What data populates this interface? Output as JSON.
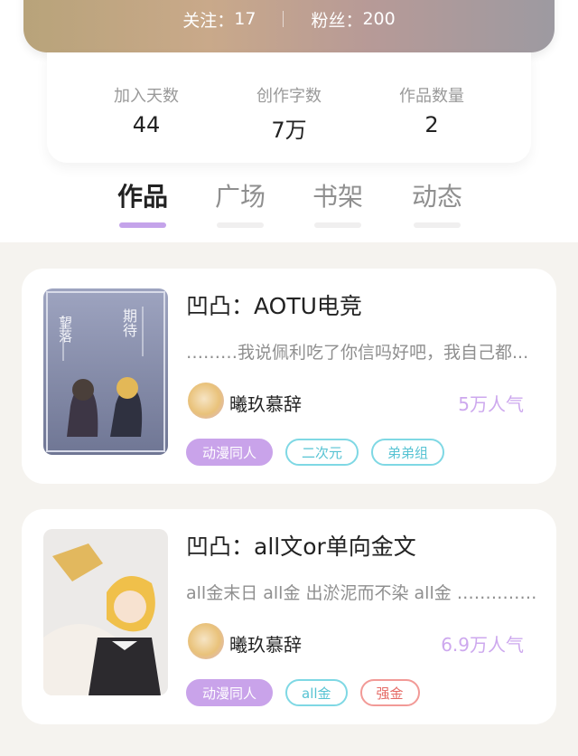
{
  "profile": {
    "following_label": "关注：",
    "following_value": "17",
    "fans_label": "粉丝：",
    "fans_value": "200"
  },
  "stats": [
    {
      "label": "加入天数",
      "value": "44"
    },
    {
      "label": "创作字数",
      "value": "7万"
    },
    {
      "label": "作品数量",
      "value": "2"
    }
  ],
  "tabs": [
    {
      "label": "作品",
      "active": true
    },
    {
      "label": "广场",
      "active": false
    },
    {
      "label": "书架",
      "active": false
    },
    {
      "label": "动态",
      "active": false
    }
  ],
  "works": [
    {
      "title": "凹凸：AOTU电竞",
      "excerpt": "………我说佩利吃了你信吗好吧，我自己都...",
      "author": "曦玖慕辞",
      "popularity": "5万人气",
      "cover_text": [
        "望落",
        "期待"
      ],
      "tags": [
        {
          "label": "动漫同人",
          "style": "fill"
        },
        {
          "label": "二次元",
          "style": "cyan"
        },
        {
          "label": "弟弟组",
          "style": "cyan"
        }
      ]
    },
    {
      "title": "凹凸：all文or单向金文",
      "excerpt": "all金末日 all金 出淤泥而不染 all金 ……………",
      "author": "曦玖慕辞",
      "popularity": "6.9万人气",
      "tags": [
        {
          "label": "动漫同人",
          "style": "fill"
        },
        {
          "label": "all金",
          "style": "cyan"
        },
        {
          "label": "强金",
          "style": "red"
        }
      ]
    }
  ],
  "colors": {
    "accent_purple": "#c9a3ea",
    "tag_cyan": "#7fd8e4",
    "tag_red": "#f29a97"
  }
}
